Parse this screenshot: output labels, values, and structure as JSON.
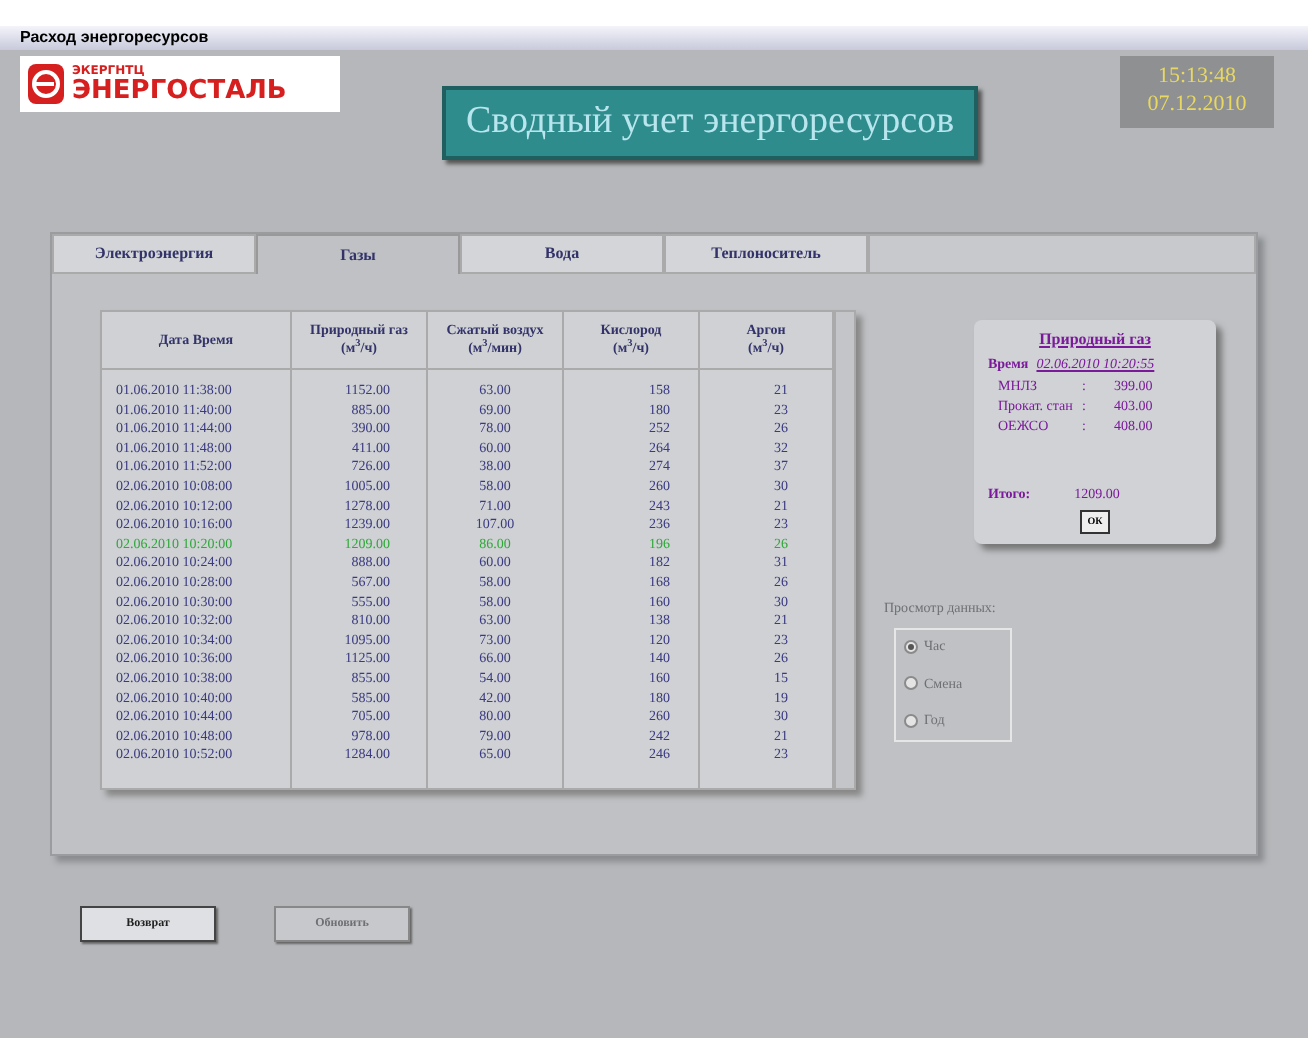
{
  "window": {
    "title": "Расход энергоресурсов"
  },
  "header": {
    "logo_small": "ЭКЕРГНТЦ",
    "logo": "ЭНЕРГОСТАЛЬ",
    "title": "Сводный учет энергоресурсов",
    "clock_time": "15:13:48",
    "clock_date": "07.12.2010"
  },
  "tabs": [
    {
      "label": "Электроэнергия",
      "selected": false
    },
    {
      "label": "Газы",
      "selected": true
    },
    {
      "label": "Вода",
      "selected": false
    },
    {
      "label": "Теплоноситель",
      "selected": false
    }
  ],
  "table": {
    "columns": [
      {
        "title": "Дата Время"
      },
      {
        "title": "Природный газ",
        "unit": "(м$^{3}$/ч)"
      },
      {
        "title": "Сжатый воздух",
        "unit": "(м$^{3}$/мин)"
      },
      {
        "title": "Кислород",
        "unit": "(м$^{3}$/ч)"
      },
      {
        "title": "Аргон",
        "unit": "(м$^{3}$/ч)"
      }
    ],
    "rows": [
      {
        "cells": [
          "01.06.2010 11:38:00",
          "1152.00",
          "63.00",
          "158",
          "21"
        ],
        "selected": false
      },
      {
        "cells": [
          "01.06.2010 11:40:00",
          "885.00",
          "69.00",
          "180",
          "23"
        ],
        "selected": false
      },
      {
        "cells": [
          "01.06.2010 11:44:00",
          "390.00",
          "78.00",
          "252",
          "26"
        ],
        "selected": false
      },
      {
        "cells": [
          "01.06.2010 11:48:00",
          "411.00",
          "60.00",
          "264",
          "32"
        ],
        "selected": false
      },
      {
        "cells": [
          "01.06.2010 11:52:00",
          "726.00",
          "38.00",
          "274",
          "37"
        ],
        "selected": false
      },
      {
        "cells": [
          "02.06.2010 10:08:00",
          "1005.00",
          "58.00",
          "260",
          "30"
        ],
        "selected": false
      },
      {
        "cells": [
          "02.06.2010 10:12:00",
          "1278.00",
          "71.00",
          "243",
          "21"
        ],
        "selected": false
      },
      {
        "cells": [
          "02.06.2010 10:16:00",
          "1239.00",
          "107.00",
          "236",
          "23"
        ],
        "selected": false
      },
      {
        "cells": [
          "02.06.2010 10:20:00",
          "1209.00",
          "86.00",
          "196",
          "26"
        ],
        "selected": true
      },
      {
        "cells": [
          "02.06.2010 10:24:00",
          "888.00",
          "60.00",
          "182",
          "31"
        ],
        "selected": false
      },
      {
        "cells": [
          "02.06.2010 10:28:00",
          "567.00",
          "58.00",
          "168",
          "26"
        ],
        "selected": false
      },
      {
        "cells": [
          "02.06.2010 10:30:00",
          "555.00",
          "58.00",
          "160",
          "30"
        ],
        "selected": false
      },
      {
        "cells": [
          "02.06.2010 10:32:00",
          "810.00",
          "63.00",
          "138",
          "21"
        ],
        "selected": false
      },
      {
        "cells": [
          "02.06.2010 10:34:00",
          "1095.00",
          "73.00",
          "120",
          "23"
        ],
        "selected": false
      },
      {
        "cells": [
          "02.06.2010 10:36:00",
          "1125.00",
          "66.00",
          "140",
          "26"
        ],
        "selected": false
      },
      {
        "cells": [
          "02.06.2010 10:38:00",
          "855.00",
          "54.00",
          "160",
          "15"
        ],
        "selected": false
      },
      {
        "cells": [
          "02.06.2010 10:40:00",
          "585.00",
          "42.00",
          "180",
          "19"
        ],
        "selected": false
      },
      {
        "cells": [
          "02.06.2010 10:44:00",
          "705.00",
          "80.00",
          "260",
          "30"
        ],
        "selected": false
      },
      {
        "cells": [
          "02.06.2010 10:48:00",
          "978.00",
          "79.00",
          "242",
          "21"
        ],
        "selected": false
      },
      {
        "cells": [
          "02.06.2010 10:52:00",
          "1284.00",
          "65.00",
          "246",
          "23"
        ],
        "selected": false
      }
    ]
  },
  "detail": {
    "title": "Природный газ",
    "time_label": "Время",
    "time": "02.06.2010 10:20:55",
    "items": [
      {
        "name": "МНЛЗ",
        "sep": ":",
        "value": "399.00"
      },
      {
        "name": "Прокат. стан",
        "sep": ":",
        "value": "403.00"
      },
      {
        "name": "ОЕЖСО",
        "sep": ":",
        "value": "408.00"
      }
    ],
    "total_label": "Итого:",
    "total": "1209.00",
    "ok": "ОК"
  },
  "view": {
    "label": "Просмотр данных:",
    "disabled": true,
    "options": [
      {
        "label": "Час",
        "selected": true
      },
      {
        "label": "Смена",
        "selected": false
      },
      {
        "label": "Год",
        "selected": false
      }
    ]
  },
  "buttons": [
    {
      "label": "Возврат",
      "disabled": false
    },
    {
      "label": "Обновить",
      "disabled": true
    }
  ]
}
